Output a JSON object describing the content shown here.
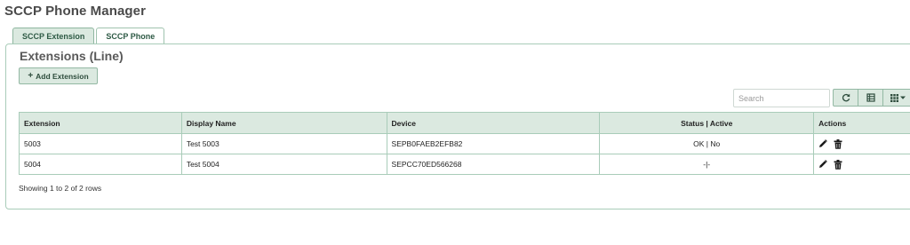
{
  "page": {
    "title": "SCCP Phone Manager"
  },
  "tabs": [
    {
      "label": "SCCP Extension",
      "active": true
    },
    {
      "label": "SCCP Phone",
      "active": false
    }
  ],
  "section": {
    "title": "Extensions (Line)"
  },
  "add_button": {
    "label": "Add Extension",
    "icon": "plus-icon"
  },
  "search": {
    "placeholder": "Search",
    "value": ""
  },
  "toolbar": [
    {
      "name": "refresh-button",
      "icon": "refresh-icon"
    },
    {
      "name": "toggle-view-button",
      "icon": "list-view-icon"
    },
    {
      "name": "columns-button",
      "icon": "columns-grid-icon"
    }
  ],
  "table": {
    "columns": [
      "Extension",
      "Display Name",
      "Device",
      "Status | Active",
      "Actions"
    ],
    "rows": [
      {
        "extension": "5003",
        "display_name": "Test 5003",
        "device": "SEPB0FAEB2EFB82",
        "status": "OK | No"
      },
      {
        "extension": "5004",
        "display_name": "Test 5004",
        "device": "SEPCC70ED566268",
        "status": "-|-"
      }
    ]
  },
  "footer": {
    "rows_info": "Showing 1 to 2 of 2 rows"
  },
  "colors": {
    "accent_bg": "#dbe9e0",
    "accent_border": "#93b8a3",
    "accent_text": "#2e5a45"
  }
}
